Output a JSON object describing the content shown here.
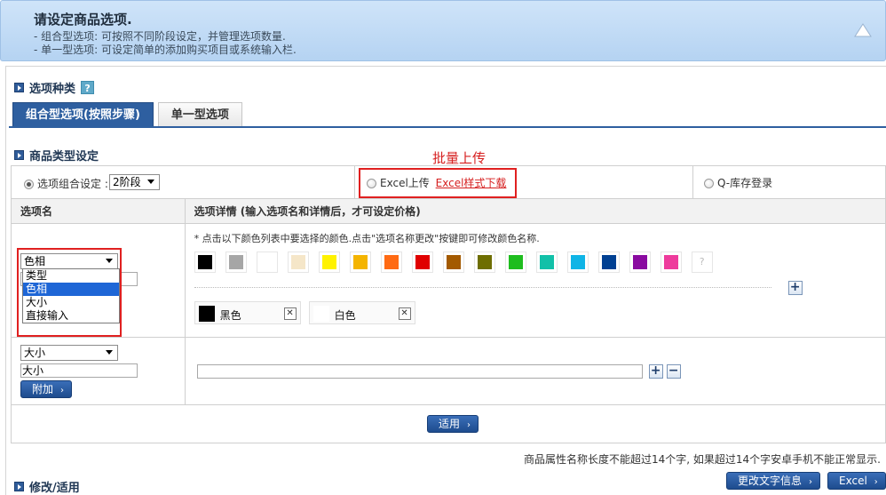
{
  "header": {
    "title": "请设定商品选项.",
    "line1": "- 组合型选项: 可按照不同阶段设定，并管理选项数量.",
    "line2": "- 单一型选项: 可设定简单的添加购买项目或系统输入栏."
  },
  "option_type": {
    "heading": "选项种类",
    "help": "?"
  },
  "tabs": [
    {
      "label": "组合型选项(按照步骤)",
      "active": true
    },
    {
      "label": "单一型选项",
      "active": false
    }
  ],
  "product_type": {
    "heading": "商品类型设定"
  },
  "annotation": {
    "bulk_upload": "批量上传"
  },
  "settings": {
    "combo_label": "选项组合设定 :",
    "combo_value": "2阶段",
    "excel_upload": "Excel上传",
    "excel_download": "Excel样式下载",
    "q_stock": "Q-库存登录"
  },
  "table_head": {
    "col1": "选项名",
    "col2": "选项详情 (输入选项名和详情后，才可设定价格)"
  },
  "row1": {
    "select_value": "色相",
    "dropdown_options": [
      "类型",
      "色相",
      "大小",
      "直接输入"
    ],
    "dropdown_selected": "色相",
    "note": "* 点击以下颜色列表中要选择的颜色.点击\"选项名称更改\"按键即可修改颜色名称.",
    "swatch_colors": [
      "#000000",
      "#a6a6a6",
      "#ffffff",
      "#f5e6c8",
      "#fff200",
      "#f4b400",
      "#ff6a13",
      "#e00000",
      "#a35a00",
      "#6e6e00",
      "#1ebd1e",
      "#12c0a8",
      "#0fb4e6",
      "#004092",
      "#8a0aa0",
      "#ee3b9c"
    ],
    "unknown_swatch": "?",
    "chips": [
      {
        "label": "黑色",
        "color": "#000000"
      },
      {
        "label": "白色",
        "color": "#ffffff"
      }
    ],
    "remove_glyph": "✕",
    "add_glyph": "+"
  },
  "row2": {
    "select_value": "大小",
    "input_value": "大小",
    "add_button": "附加",
    "plus": "+",
    "minus": "−"
  },
  "apply_button": "适用",
  "footer_note": "商品属性名称长度不能超过14个字, 如果超过14个字安卓手机不能正常显示.",
  "edit_section": {
    "heading": "修改/适用"
  },
  "bottom_buttons": {
    "change_text": "更改文字信息",
    "excel": "Excel"
  }
}
